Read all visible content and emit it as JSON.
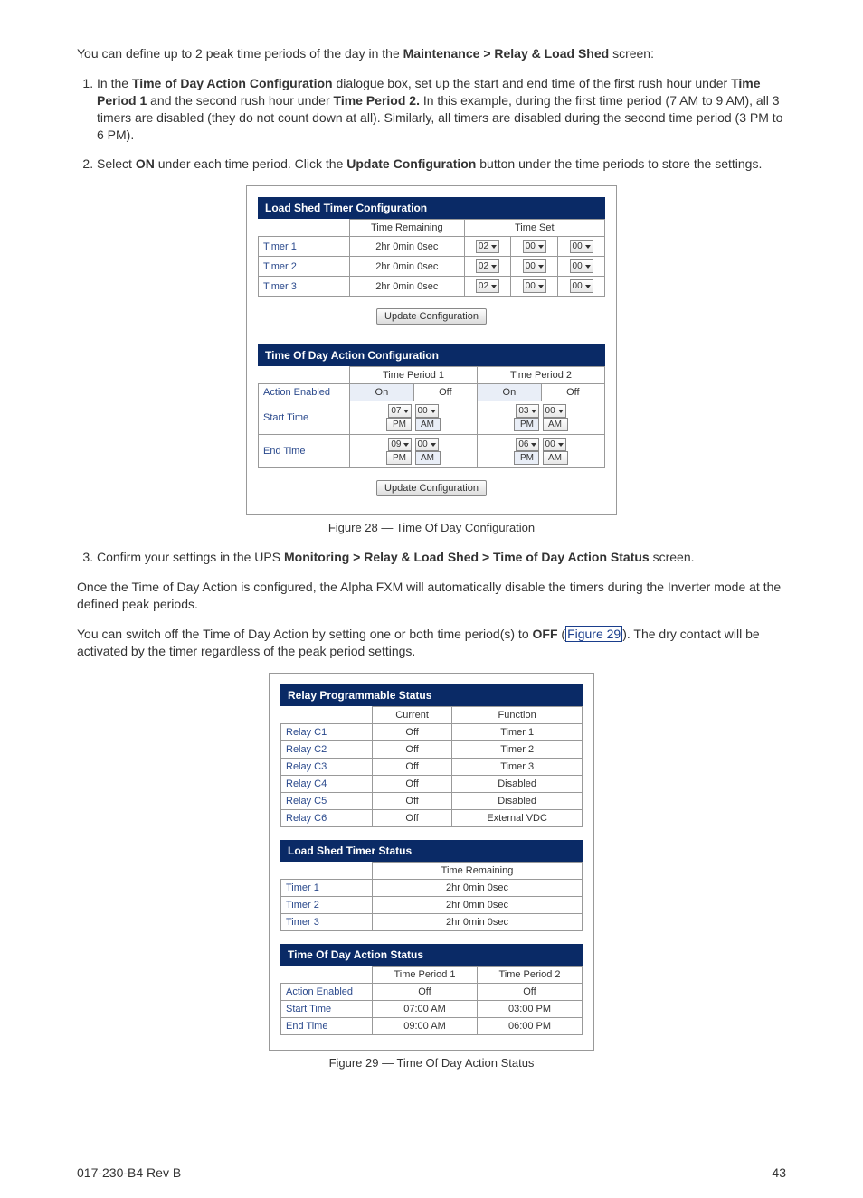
{
  "intro": "You can define up to 2 peak time periods of the day in the ",
  "introBold": "Maintenance > Relay & Load Shed",
  "introTail": " screen:",
  "step1_a": "In the ",
  "step1_b": "Time of Day Action Configuration",
  "step1_c": " dialogue box, set up the start and end time of the first rush hour under ",
  "step1_d": "Time Period 1",
  "step1_e": " and the second rush hour under ",
  "step1_f": "Time Period 2.",
  "step1_g": " In this example, during the first time period (7 AM to 9 AM), all 3 timers are disabled (they do not count down at all). Similarly, all timers are disabled during the second time period (3 PM to 6 PM).",
  "step2_a": "Select ",
  "step2_b": "ON",
  "step2_c": " under each time period. Click the ",
  "step2_d": "Update Configuration",
  "step2_e": " button under the time periods to store the settings.",
  "fig28": {
    "banner1": "Load Shed Timer Configuration",
    "colRemain": "Time Remaining",
    "colSet": "Time Set",
    "rows": [
      {
        "name": "Timer 1",
        "remain": "2hr 0min 0sec",
        "h": "02",
        "m": "00",
        "s": "00"
      },
      {
        "name": "Timer 2",
        "remain": "2hr 0min 0sec",
        "h": "02",
        "m": "00",
        "s": "00"
      },
      {
        "name": "Timer 3",
        "remain": "2hr 0min 0sec",
        "h": "02",
        "m": "00",
        "s": "00"
      }
    ],
    "btn": "Update Configuration",
    "banner2": "Time Of Day Action Configuration",
    "tp1": "Time Period 1",
    "tp2": "Time Period 2",
    "rowAE": "Action Enabled",
    "on": "On",
    "off": "Off",
    "rowST": "Start Time",
    "rowET": "End Time",
    "st1h": "07",
    "st1m": "00",
    "st1p": "PM",
    "st1a": "AM",
    "et1h": "09",
    "et1m": "00",
    "et1p": "PM",
    "et1a": "AM",
    "st2h": "03",
    "st2m": "00",
    "st2p": "PM",
    "st2a": "AM",
    "et2h": "06",
    "et2m": "00",
    "et2p": "PM",
    "et2a": "AM",
    "caption": "Figure 28  —  Time Of Day Configuration"
  },
  "step3_a": "Confirm your settings in the UPS ",
  "step3_b": "Monitoring > Relay & Load Shed > Time of Day Action Status",
  "step3_c": " screen.",
  "para_once": "Once the Time of Day Action is configured, the Alpha FXM will automatically disable the timers during the Inverter mode at the defined peak periods.",
  "para_off_a": "You can switch off the Time of Day Action by setting one or both time period(s) to ",
  "para_off_b": "OFF",
  "para_off_c": " (",
  "para_off_link": "Figure 29",
  "para_off_d": "). The dry contact will be activated by the timer regardless of the peak period settings.",
  "fig29": {
    "banner1": "Relay Programmable Status",
    "colCur": "Current",
    "colFun": "Function",
    "relays": [
      {
        "name": "Relay C1",
        "cur": "Off",
        "fun": "Timer 1"
      },
      {
        "name": "Relay C2",
        "cur": "Off",
        "fun": "Timer 2"
      },
      {
        "name": "Relay C3",
        "cur": "Off",
        "fun": "Timer 3"
      },
      {
        "name": "Relay C4",
        "cur": "Off",
        "fun": "Disabled"
      },
      {
        "name": "Relay C5",
        "cur": "Off",
        "fun": "Disabled"
      },
      {
        "name": "Relay C6",
        "cur": "Off",
        "fun": "External VDC"
      }
    ],
    "banner2": "Load Shed Timer Status",
    "colRemain": "Time Remaining",
    "timers": [
      {
        "name": "Timer 1",
        "remain": "2hr 0min 0sec"
      },
      {
        "name": "Timer 2",
        "remain": "2hr 0min 0sec"
      },
      {
        "name": "Timer 3",
        "remain": "2hr 0min 0sec"
      }
    ],
    "banner3": "Time Of Day Action Status",
    "tp1": "Time Period 1",
    "tp2": "Time Period 2",
    "rows": [
      {
        "name": "Action Enabled",
        "p1": "Off",
        "p2": "Off"
      },
      {
        "name": "Start Time",
        "p1": "07:00 AM",
        "p2": "03:00 PM"
      },
      {
        "name": "End Time",
        "p1": "09:00 AM",
        "p2": "06:00 PM"
      }
    ],
    "caption": "Figure 29  —  Time Of Day Action Status"
  },
  "footerLeft": "017-230-B4    Rev B",
  "footerRight": "43"
}
